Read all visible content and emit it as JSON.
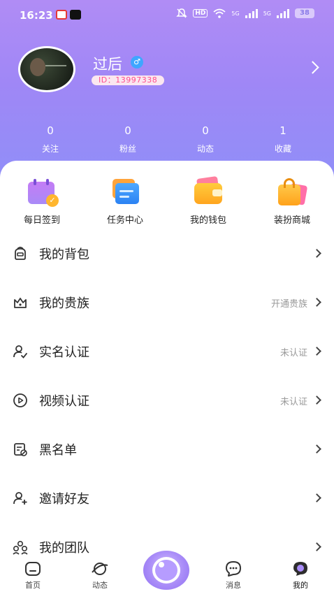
{
  "status_bar": {
    "time": "16:23",
    "battery": "38",
    "hd": "HD",
    "net_5g_1": "5G",
    "net_5g_2": "5G"
  },
  "profile": {
    "name": "过后",
    "gender_symbol": "♂",
    "id_text": "ID：13997338"
  },
  "stats": [
    {
      "value": "0",
      "label": "关注"
    },
    {
      "value": "0",
      "label": "粉丝"
    },
    {
      "value": "0",
      "label": "动态"
    },
    {
      "value": "1",
      "label": "收藏"
    }
  ],
  "quick_actions": [
    {
      "label": "每日签到",
      "icon": "calendar-check-icon"
    },
    {
      "label": "任务中心",
      "icon": "task-center-icon"
    },
    {
      "label": "我的钱包",
      "icon": "wallet-icon"
    },
    {
      "label": "装扮商城",
      "icon": "shopping-bag-icon"
    }
  ],
  "menu": [
    {
      "label": "我的背包",
      "status": "",
      "icon": "backpack-icon"
    },
    {
      "label": "我的贵族",
      "status": "开通贵族",
      "icon": "crown-icon"
    },
    {
      "label": "实名认证",
      "status": "未认证",
      "icon": "user-verify-icon"
    },
    {
      "label": "视频认证",
      "status": "未认证",
      "icon": "video-verify-icon"
    },
    {
      "label": "黑名单",
      "status": "",
      "icon": "blacklist-icon"
    },
    {
      "label": "邀请好友",
      "status": "",
      "icon": "invite-friend-icon"
    },
    {
      "label": "我的团队",
      "status": "",
      "icon": "team-icon"
    }
  ],
  "bottom_nav": {
    "home": "首页",
    "moments": "动态",
    "messages": "消息",
    "mine": "我的"
  },
  "colors": {
    "header_top": "#b08cf5",
    "header_bottom": "#8f8ff8",
    "id_pill_text": "#ff4d8d",
    "gender_badge": "#3ea6ff"
  }
}
